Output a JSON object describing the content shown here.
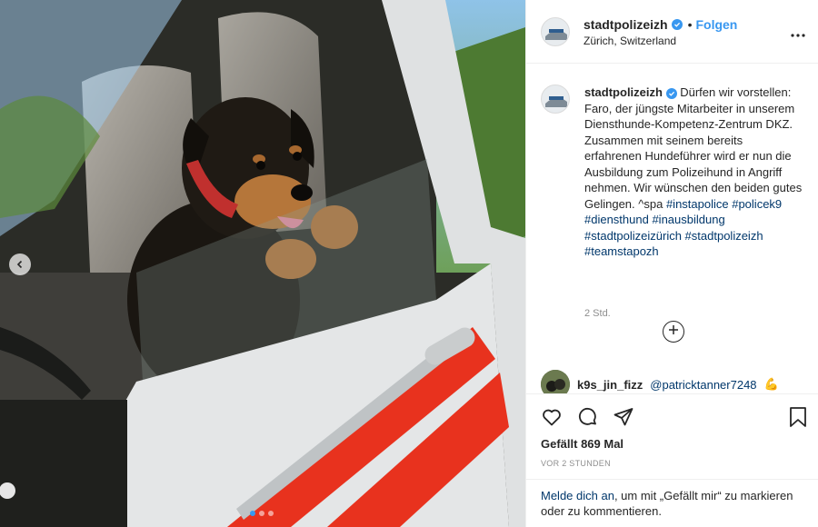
{
  "post": {
    "username": "stadtpolizeizh",
    "follow_label": "Folgen",
    "separator": "•",
    "location": "Zürich, Switzerland",
    "more_icon": "more-dots-icon",
    "caption_body": "Dürfen wir vorstellen: Faro, der jüngste Mitarbeiter in unserem Diensthunde-Kompetenz-Zentrum DKZ. Zusammen mit seinem bereits erfahrenen Hundeführer wird er nun die Ausbildung zum Polizeihund in Angriff nehmen. Wir wünschen den beiden gutes Gelingen. ^spa",
    "hashtags": "#instapolice #policek9 #diensthund #inausbildung #stadtpolizeizürich #stadtpolizeizh #teamstapozh",
    "caption_time": "2 Std.",
    "load_more_icon": "plus-circle-icon",
    "comment": {
      "username": "k9s_jin_fizz",
      "mention": "@patricktanner7248",
      "emoji": "💪"
    },
    "likes": "Gefällt 869 Mal",
    "posted_ago": "VOR 2 STUNDEN"
  },
  "login_prompt": {
    "link": "Melde dich an",
    "text": ", um mit „Gefällt mir“ zu markieren oder zu kommentieren."
  },
  "colors": {
    "accent": "#3897f0",
    "link": "#00376b",
    "muted": "#8e8e8e",
    "text": "#262626"
  },
  "carousel": {
    "prev_icon": "chevron-left-icon",
    "current_slide": 1,
    "slide_count": 3
  }
}
